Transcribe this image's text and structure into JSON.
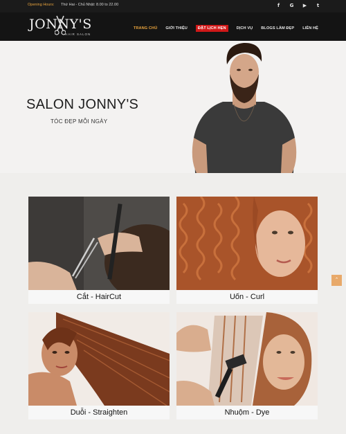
{
  "topbar": {
    "hours_label": "Opening Hours:",
    "hours_value": "Thứ Hai - Chủ Nhật: 8.00 to 22.00",
    "social": [
      {
        "icon": "facebook-icon",
        "glyph": "f"
      },
      {
        "icon": "google-icon",
        "glyph": "G"
      },
      {
        "icon": "youtube-icon",
        "glyph": "▶"
      },
      {
        "icon": "twitter-icon",
        "glyph": "t"
      }
    ]
  },
  "logo": {
    "name": "JONNY'S",
    "sub": "HAIR SALON"
  },
  "nav": {
    "home": "TRANG CHỦ",
    "about": "GIỚI THIỆU",
    "booking": "ĐẶT LỊCH HẸN",
    "services": "DỊCH VỤ",
    "blog": "BLOGS LÀM ĐẸP",
    "contact": "LIÊN HỆ"
  },
  "hero": {
    "title": "SALON JONNY'S",
    "tagline": "TÓC ĐẸP MỖI NGÀY"
  },
  "services": [
    {
      "caption": "Cắt - HairCut"
    },
    {
      "caption": "Uốn - Curl"
    },
    {
      "caption": "Duỗi - Straighten"
    },
    {
      "caption": "Nhuộm - Dye"
    }
  ],
  "scroll_top": {
    "icon": "chevron-up-icon",
    "glyph": "⌃"
  },
  "colors": {
    "accent": "#e8a33d",
    "booking_bg": "#d01818",
    "header_bg": "#141414"
  }
}
